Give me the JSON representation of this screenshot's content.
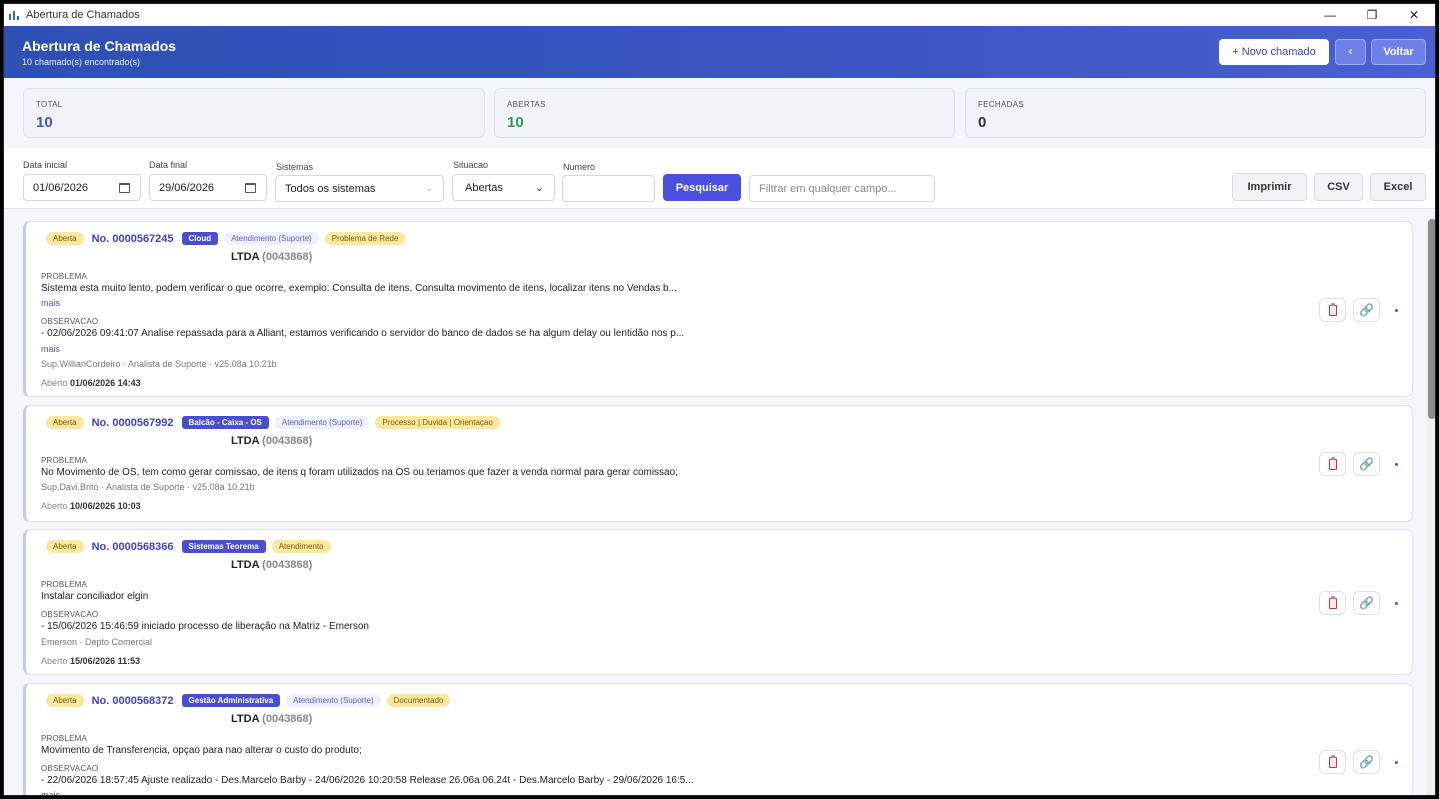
{
  "window": {
    "title": "Abertura de Chamados",
    "min": "—",
    "restore": "❐",
    "close": "✕"
  },
  "header": {
    "title": "Abertura de Chamados",
    "subtitle": "10 chamado(s) encontrado(s)",
    "novo_label": "+ Novo chamado",
    "back_label": "‹",
    "voltar_label": "Voltar"
  },
  "stats": {
    "total": {
      "label": "TOTAL",
      "value": "10",
      "color": "#4a4fd0"
    },
    "abertas": {
      "label": "ABERTAS",
      "value": "10",
      "color": "#2e9b4f"
    },
    "fechadas": {
      "label": "FECHADAS",
      "value": "0",
      "color": "#333333"
    }
  },
  "filters": {
    "data_inicial": {
      "label": "Data inicial",
      "value": "01/06/2026"
    },
    "data_final": {
      "label": "Data final",
      "value": "29/06/2026"
    },
    "sistemas": {
      "label": "Sistemas",
      "value": "Todos os sistemas"
    },
    "situacao": {
      "label": "Situacao",
      "value": "Abertas"
    },
    "numero": {
      "label": "Numero",
      "value": ""
    },
    "pesquisar_label": "Pesquisar",
    "filtro_placeholder": "Filtrar em qualquer campo...",
    "imprimir_label": "Imprimir",
    "csv_label": "CSV",
    "excel_label": "Excel"
  },
  "labels": {
    "problema": "PROBLEMA",
    "observacao": "OBSERVACAO",
    "mais": "mais",
    "aberto": "Aberto"
  },
  "chamados": [
    {
      "status": "Aberta",
      "numero": "No. 0000567245",
      "sistema": "Cloud",
      "atendimento": "Atendimento (Suporte)",
      "tipo": "Problema de Rede",
      "empresa": "LTDA",
      "codigo": "(0043868)",
      "problema": "Sistema esta muito lento, podem verificar o que ocorre, exemplo: Consulta de itens, Consulta movimento de itens, localizar itens no Vendas b...",
      "observacao": "- 02/06/2026 09:41:07 Analise repassada para a Alliant, estamos verificando o servidor do banco de dados se ha algum delay ou lentidão nos p...",
      "meta": "Sup.WillianCordeiro · Analista de Suporte · v25.08a 10.21b",
      "aberto": "01/06/2026 14:43"
    },
    {
      "status": "Aberta",
      "numero": "No. 0000567992",
      "sistema": "Balcão - Caixa - OS",
      "atendimento": "Atendimento (Suporte)",
      "tipo": "Processo | Duvida | Orientaçao",
      "empresa": "LTDA",
      "codigo": "(0043868)",
      "problema": "No Movimento de OS, tem como gerar comissao, de itens q foram utilizados na OS ou teriamos que fazer a venda normal para gerar comissao;",
      "meta": "Sup.Davi.Brito · Analista de Suporte · v25.08a 10.21b",
      "aberto": "10/06/2026 10:03"
    },
    {
      "status": "Aberta",
      "numero": "No. 0000568366",
      "sistema": "Sistemas Teorema",
      "tipo": "Atendimento",
      "empresa": "LTDA",
      "codigo": "(0043868)",
      "problema": "Instalar conciliador elgin",
      "observacao": "- 15/06/2026 15:46:59 iniciado processo de liberação na Matriz - Emerson",
      "meta": "Emerson · Depto Comercial",
      "aberto": "15/06/2026 11:53"
    },
    {
      "status": "Aberta",
      "numero": "No. 0000568372",
      "sistema": "Gestão Administrativa",
      "atendimento": "Atendimento (Suporte)",
      "tipo": "Documentado",
      "empresa": "LTDA",
      "codigo": "(0043868)",
      "problema": "Movimento de Transferencia, opçao para nao alterar o custo do produto;",
      "observacao": "- 22/06/2026 18:57:45 Ajuste realizado - Des.Marcelo Barby - 24/06/2026 10:20:58 Release 26.06a 06.24t - Des.Marcelo Barby - 29/06/2026 16:5..."
    }
  ]
}
